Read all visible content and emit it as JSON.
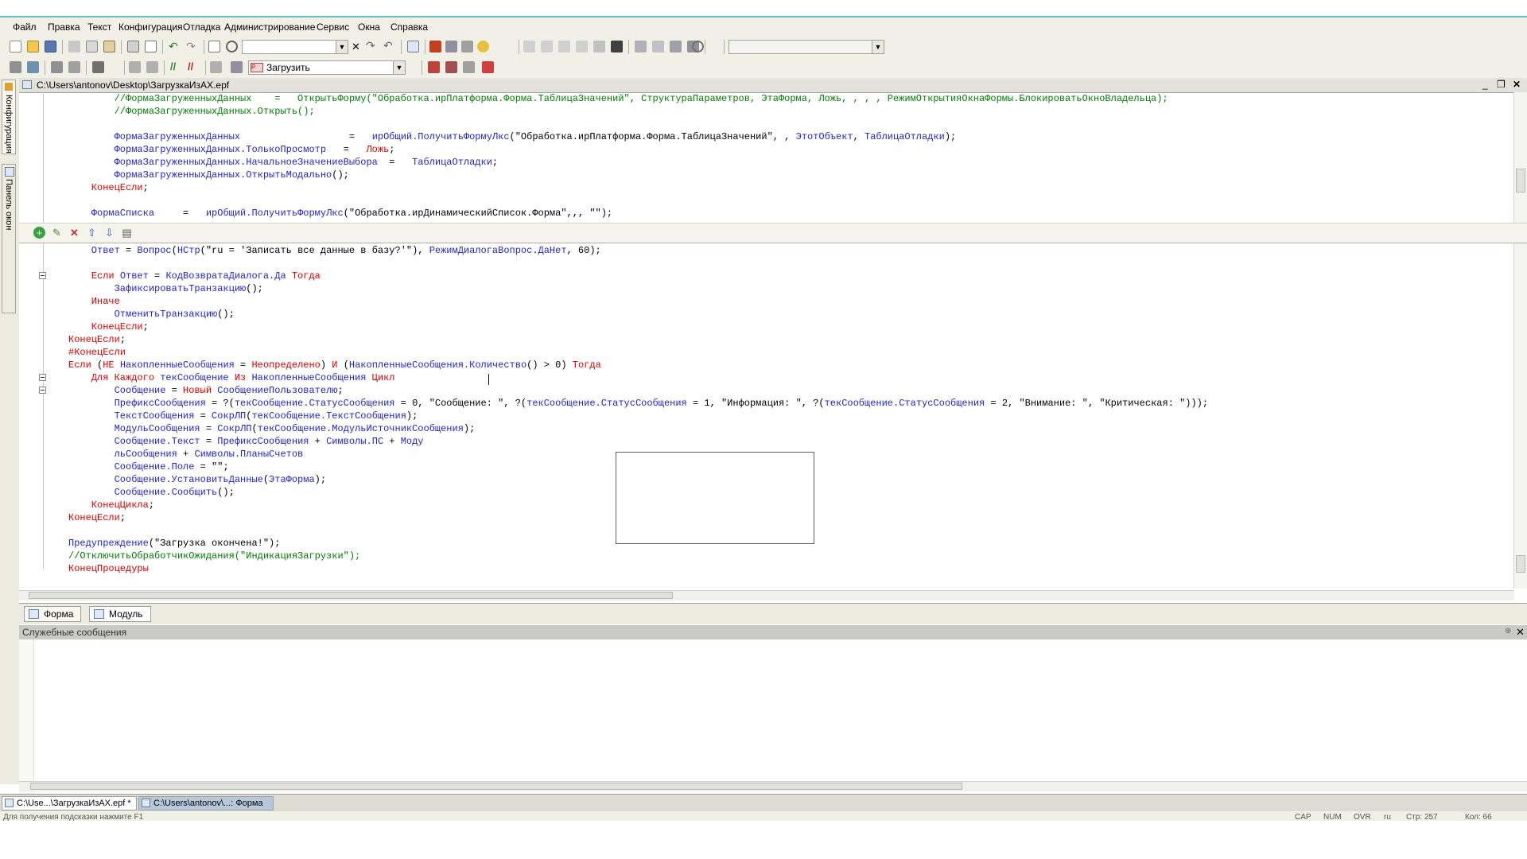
{
  "menu": [
    "Файл",
    "Правка",
    "Текст",
    "Конфигурация",
    "Отладка",
    "Администрирование",
    "Сервис",
    "Окна",
    "Справка"
  ],
  "toolbar": {
    "search_value": "",
    "action_select": "Загрузить",
    "right_select": ""
  },
  "left_panel": {
    "config_tab": "Конфигурация",
    "windows_tab": "Панель окон"
  },
  "document": {
    "title": "C:\\Users\\antonov\\Desktop\\ЗагрузкаИзАХ.epf",
    "top_code": [
      [
        [
          "cm",
          "        //ФормаЗагруженныхДанных    =   ОткрытьФорму(\"Обработка.ирПлатформа.Форма.ТаблицаЗначений\", СтруктураПараметров, ЭтаФорма, Ложь, , , , РежимОткрытияОкнаФормы.БлокироватьОкноВладельца);"
        ]
      ],
      [
        [
          "cm",
          "        //ФормаЗагруженныхДанных.Открыть();"
        ]
      ],
      [],
      [
        [
          "id",
          "        ФормаЗагруженныхДанных"
        ],
        [
          "str",
          "                   =   "
        ],
        [
          "id",
          "ирОбщий.ПолучитьФормуЛкс"
        ],
        [
          "str",
          "(\"Обработка.ирПлатформа.Форма.ТаблицаЗначений\", , "
        ],
        [
          "id",
          "ЭтотОбъект"
        ],
        [
          "str",
          ", "
        ],
        [
          "id",
          "ТаблицаОтладки"
        ],
        [
          "str",
          ");"
        ]
      ],
      [
        [
          "id",
          "        ФормаЗагруженныхДанных.ТолькоПросмотр"
        ],
        [
          "str",
          "   =   "
        ],
        [
          "kw",
          "Ложь"
        ],
        [
          "str",
          ";"
        ]
      ],
      [
        [
          "id",
          "        ФормаЗагруженныхДанных.НачальноеЗначениеВыбора"
        ],
        [
          "str",
          "  =   "
        ],
        [
          "id",
          "ТаблицаОтладки"
        ],
        [
          "str",
          ";"
        ]
      ],
      [
        [
          "id",
          "        ФормаЗагруженныхДанных.ОткрытьМодально"
        ],
        [
          "str",
          "();"
        ]
      ],
      [
        [
          "kw",
          "    КонецЕсли"
        ],
        [
          "str",
          ";"
        ]
      ],
      [],
      [
        [
          "id",
          "    ФормаСписка"
        ],
        [
          "str",
          "     =   "
        ],
        [
          "id",
          "ирОбщий.ПолучитьФормуЛкс"
        ],
        [
          "str",
          "(\"Обработка.ирДинамическийСписок.Форма\",,, \"\");"
        ]
      ]
    ],
    "bottom_code": [
      [
        [
          "id",
          "    Ответ"
        ],
        [
          "str",
          " = "
        ],
        [
          "id",
          "Вопрос"
        ],
        [
          "str",
          "("
        ],
        [
          "id",
          "НСтр"
        ],
        [
          "str",
          "(\"ru = 'Записать все данные в базу?'\"), "
        ],
        [
          "id",
          "РежимДиалогаВопрос.ДаНет"
        ],
        [
          "str",
          ", 60);"
        ]
      ],
      [],
      [
        [
          "kw",
          "    Если "
        ],
        [
          "id",
          "Ответ"
        ],
        [
          "str",
          " = "
        ],
        [
          "id",
          "КодВозвратаДиалога.Да"
        ],
        [
          "kw",
          " Тогда"
        ]
      ],
      [
        [
          "id",
          "        ЗафиксироватьТранзакцию"
        ],
        [
          "str",
          "();"
        ]
      ],
      [
        [
          "kw",
          "    Иначе"
        ]
      ],
      [
        [
          "id",
          "        ОтменитьТранзакцию"
        ],
        [
          "str",
          "();"
        ]
      ],
      [
        [
          "kw",
          "    КонецЕсли"
        ],
        [
          "str",
          ";"
        ]
      ],
      [
        [
          "kw",
          "КонецЕсли"
        ],
        [
          "str",
          ";"
        ]
      ],
      [
        [
          "kw",
          "#КонецЕсли"
        ]
      ],
      [
        [
          "kw",
          "Если "
        ],
        [
          "str",
          "("
        ],
        [
          "kw",
          "НЕ "
        ],
        [
          "id",
          "НакопленныеСообщения"
        ],
        [
          "str",
          " = "
        ],
        [
          "kw",
          "Неопределено"
        ],
        [
          "str",
          ") "
        ],
        [
          "kw",
          "И "
        ],
        [
          "str",
          "("
        ],
        [
          "id",
          "НакопленныеСообщения.Количество"
        ],
        [
          "str",
          "() > 0) "
        ],
        [
          "kw",
          "Тогда"
        ]
      ],
      [
        [
          "kw",
          "    Для Каждого "
        ],
        [
          "id",
          "текСообщение"
        ],
        [
          "kw",
          " Из "
        ],
        [
          "id",
          "НакопленныеСообщения"
        ],
        [
          "kw",
          " Цикл"
        ]
      ],
      [
        [
          "id",
          "        Сообщение"
        ],
        [
          "str",
          " = "
        ],
        [
          "kw",
          "Новый "
        ],
        [
          "id",
          "СообщениеПользователю"
        ],
        [
          "str",
          ";"
        ]
      ],
      [
        [
          "id",
          "        ПрефиксСообщения"
        ],
        [
          "str",
          " = ?("
        ],
        [
          "id",
          "текСообщение.СтатусСообщения"
        ],
        [
          "str",
          " = 0, \"Сообщение: \", ?("
        ],
        [
          "id",
          "текСообщение.СтатусСообщения"
        ],
        [
          "str",
          " = 1, \"Информация: \", ?("
        ],
        [
          "id",
          "текСообщение.СтатусСообщения"
        ],
        [
          "str",
          " = 2, \"Внимание: \", \"Критическая: \")));"
        ]
      ],
      [
        [
          "id",
          "        ТекстСообщения"
        ],
        [
          "str",
          " = "
        ],
        [
          "id",
          "СокрЛП"
        ],
        [
          "str",
          "("
        ],
        [
          "id",
          "текСообщение.ТекстСообщения"
        ],
        [
          "str",
          ");"
        ]
      ],
      [
        [
          "id",
          "        МодульСообщения"
        ],
        [
          "str",
          " = "
        ],
        [
          "id",
          "СокрЛП"
        ],
        [
          "str",
          "("
        ],
        [
          "id",
          "текСообщение.МодульИсточникСообщения"
        ],
        [
          "str",
          ");"
        ]
      ],
      [
        [
          "id",
          "        Сообщение.Текст"
        ],
        [
          "str",
          " = "
        ],
        [
          "id",
          "ПрефиксСообщения"
        ],
        [
          "str",
          " + "
        ],
        [
          "id",
          "Символы.ПС"
        ],
        [
          "str",
          " + "
        ],
        [
          "id",
          "Моду"
        ]
      ],
      [
        [
          "id",
          "        льСообщения"
        ],
        [
          "str",
          " + "
        ],
        [
          "id",
          "Символы.ПланыСчетов"
        ]
      ],
      [
        [
          "id",
          "        Сообщение.Поле"
        ],
        [
          "str",
          " = \"\";"
        ]
      ],
      [
        [
          "id",
          "        Сообщение.УстановитьДанные"
        ],
        [
          "str",
          "("
        ],
        [
          "id",
          "ЭтаФорма"
        ],
        [
          "str",
          ");"
        ]
      ],
      [
        [
          "id",
          "        Сообщение.Сообщить"
        ],
        [
          "str",
          "();"
        ]
      ],
      [
        [
          "kw",
          "    КонецЦикла"
        ],
        [
          "str",
          ";"
        ]
      ],
      [
        [
          "kw",
          "КонецЕсли"
        ],
        [
          "str",
          ";"
        ]
      ],
      [],
      [
        [
          "id",
          "Предупреждение"
        ],
        [
          "str",
          "(\"Загрузка окончена!\");"
        ]
      ],
      [
        [
          "cm",
          "//ОтключитьОбработчикОжидания(\"ИндикацияЗагрузки\");"
        ]
      ],
      [
        [
          "kw",
          "КонецПроцедуры"
        ]
      ]
    ]
  },
  "bottom_tabs": [
    "Форма",
    "Модуль"
  ],
  "messages_panel": {
    "title": "Служебные сообщения"
  },
  "taskbar": [
    "C:\\Use...\\ЗагрузкаИзАХ.epf *",
    "C:\\Users\\antonov\\...: Форма"
  ],
  "statusbar": {
    "hint": "Для получения подсказки нажмите F1",
    "cap": "CAP",
    "num": "NUM",
    "ovr": "OVR",
    "ru": "ru",
    "line": "Стр: 257",
    "col": "Кол: 66"
  },
  "colors": {
    "keyword": "#e00000",
    "identifier": "#2323d8",
    "comment": "#008000",
    "chrome": "#f0f0e6",
    "accent_line": "#5ec4c8"
  }
}
